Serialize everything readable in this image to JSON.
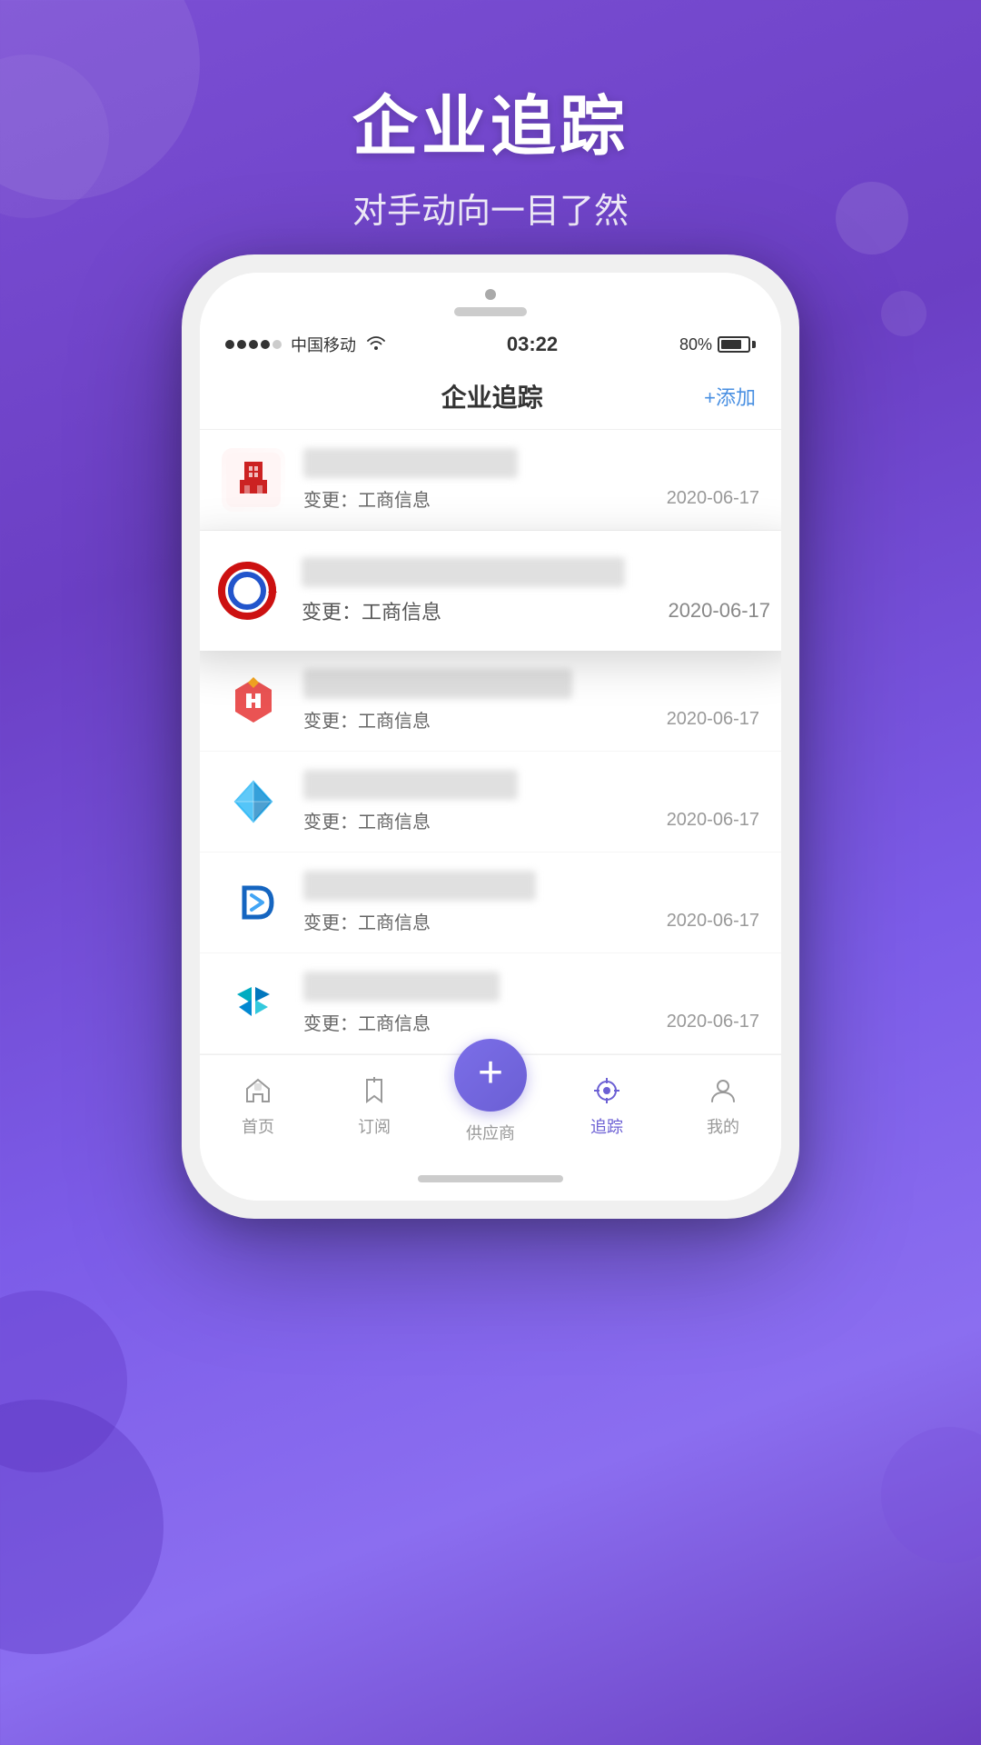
{
  "background": {
    "gradient_start": "#7b4fd4",
    "gradient_end": "#6a3fc0"
  },
  "header": {
    "main_title": "企业追踪",
    "sub_title": "对手动向一目了然"
  },
  "phone": {
    "status_bar": {
      "carrier": "中国移动",
      "signal_dots": [
        true,
        true,
        true,
        true,
        false
      ],
      "wifi": "WiFi",
      "time": "03:22",
      "battery": "80%"
    },
    "app_header": {
      "title": "企业追踪",
      "add_button": "+添加"
    },
    "companies": [
      {
        "id": 1,
        "name": "甘肃建和源商贸有限公司",
        "name_blurred": true,
        "change_type": "变更：工商信息",
        "date": "2020-06-17",
        "logo_type": "red-building"
      },
      {
        "id": 2,
        "name": "甘肃电气装备集团石水暖工程有限公司",
        "name_blurred": true,
        "change_type": "变更：工商信息",
        "date": "2020-06-17",
        "logo_type": "red-6",
        "highlighted": true
      },
      {
        "id": 3,
        "name": "兰州德嘉再生能源开发有限公司",
        "name_blurred": true,
        "change_type": "变更：工商信息",
        "date": "2020-06-17",
        "logo_type": "orange-hex"
      },
      {
        "id": 4,
        "name": "兰州生能源开发有限公司",
        "name_blurred": true,
        "change_type": "变更：工商信息",
        "date": "2020-06-17",
        "logo_type": "blue-diamond"
      },
      {
        "id": 5,
        "name": "兰州能源投资集团有限公司",
        "name_blurred": true,
        "change_type": "变更：工商信息",
        "date": "2020-06-17",
        "logo_type": "blue-d"
      },
      {
        "id": 6,
        "name": "甘肃博源广告有限公司",
        "name_blurred": true,
        "change_type": "变更：工商信息",
        "date": "2020-06-17",
        "logo_type": "blue-fy"
      }
    ],
    "bottom_nav": {
      "items": [
        {
          "label": "首页",
          "icon": "home",
          "active": false
        },
        {
          "label": "订阅",
          "icon": "bookmark",
          "active": false
        },
        {
          "label": "供应商",
          "icon": "plus",
          "active": false,
          "center": true
        },
        {
          "label": "追踪",
          "icon": "target",
          "active": true
        },
        {
          "label": "我的",
          "icon": "user",
          "active": false
        }
      ]
    }
  },
  "change_label": "变更：",
  "change_type": "工商信息"
}
